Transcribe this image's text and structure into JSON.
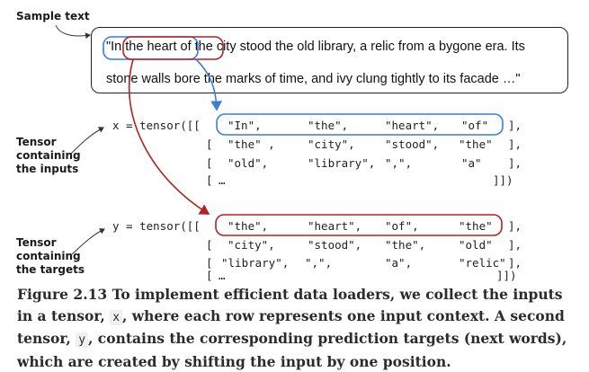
{
  "sample_label": "Sample text",
  "sample_text": {
    "line1": "\"In the heart of the city stood the old library, a relic from a bygone era. Its",
    "line2": "stone walls bore the marks of time, and ivy clung tightly to its facade …\""
  },
  "inputs_label": [
    "Tensor",
    "containing",
    "the inputs"
  ],
  "targets_label": [
    "Tensor",
    "containing",
    "the targets"
  ],
  "x_tensor": {
    "prefix": "x = tensor([[",
    "rows": [
      [
        "\"In\",",
        "\"the\",",
        "\"heart\",",
        "\"of\""
      ],
      [
        "\"the\" ,",
        "\"city\",",
        "\"stood\",",
        "\"the\""
      ],
      [
        "\"old\",",
        "\"library\",",
        "\",\",",
        "\"a\""
      ]
    ],
    "row_ends": [
      "],",
      "],",
      "],",
      "]])"
    ],
    "open_bracket": "[",
    "ellipsis": "…"
  },
  "y_tensor": {
    "prefix": "y = tensor([[",
    "rows": [
      [
        "\"the\",",
        "\"heart\",",
        "\"of\",",
        "\"the\""
      ],
      [
        "\"city\",",
        "\"stood\",",
        "\"the\",",
        "\"old\""
      ],
      [
        "\"library\",",
        "\",\",",
        "\"a\",",
        "\"relic\""
      ]
    ],
    "row_ends": [
      "],",
      "],",
      "],",
      "]])"
    ],
    "open_bracket": "[",
    "ellipsis": "…"
  },
  "caption": {
    "part1": "Figure 2.13 To implement efficient data loaders, we collect the inputs in a tensor, ",
    "x_var": "x",
    "part2": ", where each row represents one input context. A second tensor, ",
    "y_var": "y",
    "part3": ", contains the corresponding prediction targets (next words), which are created by shifting the input by one position."
  },
  "colors": {
    "input_highlight": "#3b7fd4",
    "target_highlight": "#b22222"
  }
}
